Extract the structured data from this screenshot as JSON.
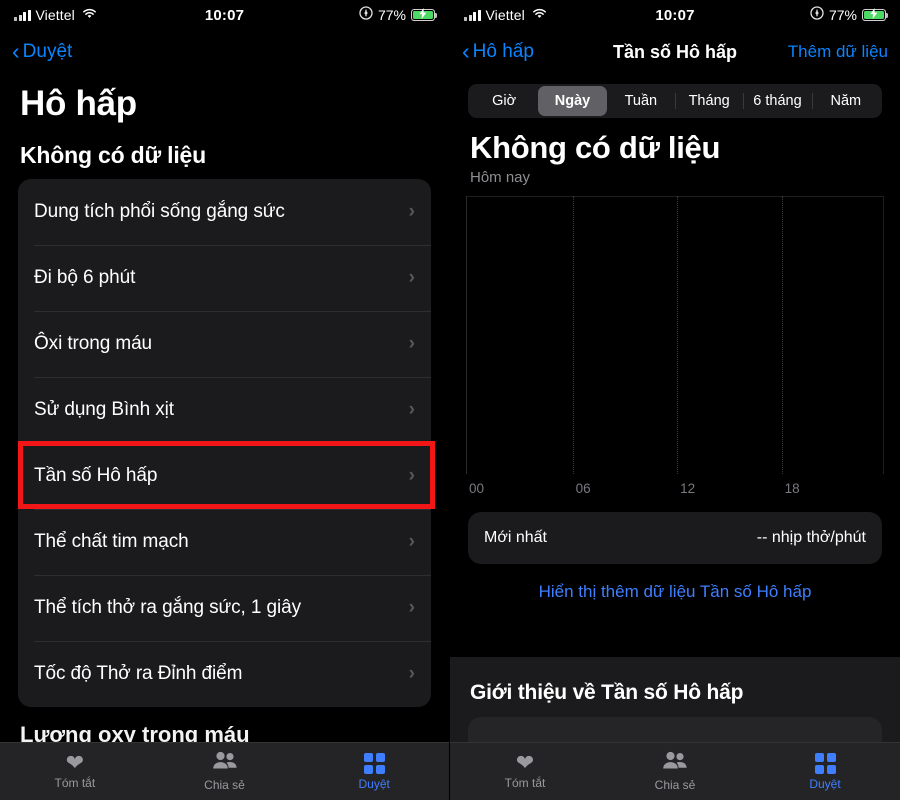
{
  "statusbar": {
    "carrier": "Viettel",
    "time": "10:07",
    "battery_pct": "77%",
    "signal_icon": "signal-bars-icon",
    "wifi_icon": "wifi-icon",
    "rotation_lock_icon": "rotation-lock-icon",
    "battery_icon": "battery-charging-icon"
  },
  "left": {
    "nav": {
      "back_label": "Duyệt"
    },
    "page_title": "Hô hấp",
    "section_title": "Không có dữ liệu",
    "rows": [
      {
        "label": "Dung tích phổi sống gắng sức"
      },
      {
        "label": "Đi bộ 6 phút"
      },
      {
        "label": "Ôxi trong máu"
      },
      {
        "label": "Sử dụng Bình xịt"
      },
      {
        "label": "Tần số Hô hấp"
      },
      {
        "label": "Thể chất tim mạch"
      },
      {
        "label": "Thể tích thở ra gắng sức, 1 giây"
      },
      {
        "label": "Tốc độ Thở ra Đỉnh điểm"
      }
    ],
    "ghost_heading": "Lượng oxy trong máu"
  },
  "right": {
    "nav": {
      "back_label": "Hô hấp",
      "title": "Tần số Hô hấp",
      "action_label": "Thêm dữ liệu"
    },
    "segments": [
      {
        "label": "Giờ",
        "selected": false
      },
      {
        "label": "Ngày",
        "selected": true
      },
      {
        "label": "Tuần",
        "selected": false
      },
      {
        "label": "Tháng",
        "selected": false
      },
      {
        "label": "6 tháng",
        "selected": false
      },
      {
        "label": "Năm",
        "selected": false
      }
    ],
    "nodata_title": "Không có dữ liệu",
    "range_label": "Hôm nay",
    "latest": {
      "label": "Mới nhất",
      "value": "-- nhịp thở/phút"
    },
    "show_more_label": "Hiển thị thêm dữ liệu Tần số Hô hấp",
    "about_title": "Giới thiệu về Tần số Hô hấp"
  },
  "tabbar": {
    "tabs": [
      {
        "label": "Tóm tắt",
        "icon": "heart-icon",
        "active": false
      },
      {
        "label": "Chia sẻ",
        "icon": "people-icon",
        "active": false
      },
      {
        "label": "Duyệt",
        "icon": "grid-icon",
        "active": true
      }
    ]
  },
  "chart_data": {
    "type": "line",
    "title": "Không có dữ liệu",
    "subtitle": "Hôm nay",
    "xlabel": "",
    "ylabel": "nhịp thở/phút",
    "x_ticks": [
      "00",
      "06",
      "12",
      "18"
    ],
    "x_tick_positions_pct": [
      0,
      25.5,
      50.5,
      75.5
    ],
    "series": [
      {
        "name": "Tần số Hô hấp",
        "values": []
      }
    ],
    "grid": true,
    "legend": "none",
    "empty": true
  },
  "highlights": {
    "color": "#f21616",
    "boxes": [
      {
        "target": "Tần số Hô hấp"
      },
      {
        "target": "Hiển thị thêm dữ liệu Tần số Hô hấp"
      }
    ]
  }
}
